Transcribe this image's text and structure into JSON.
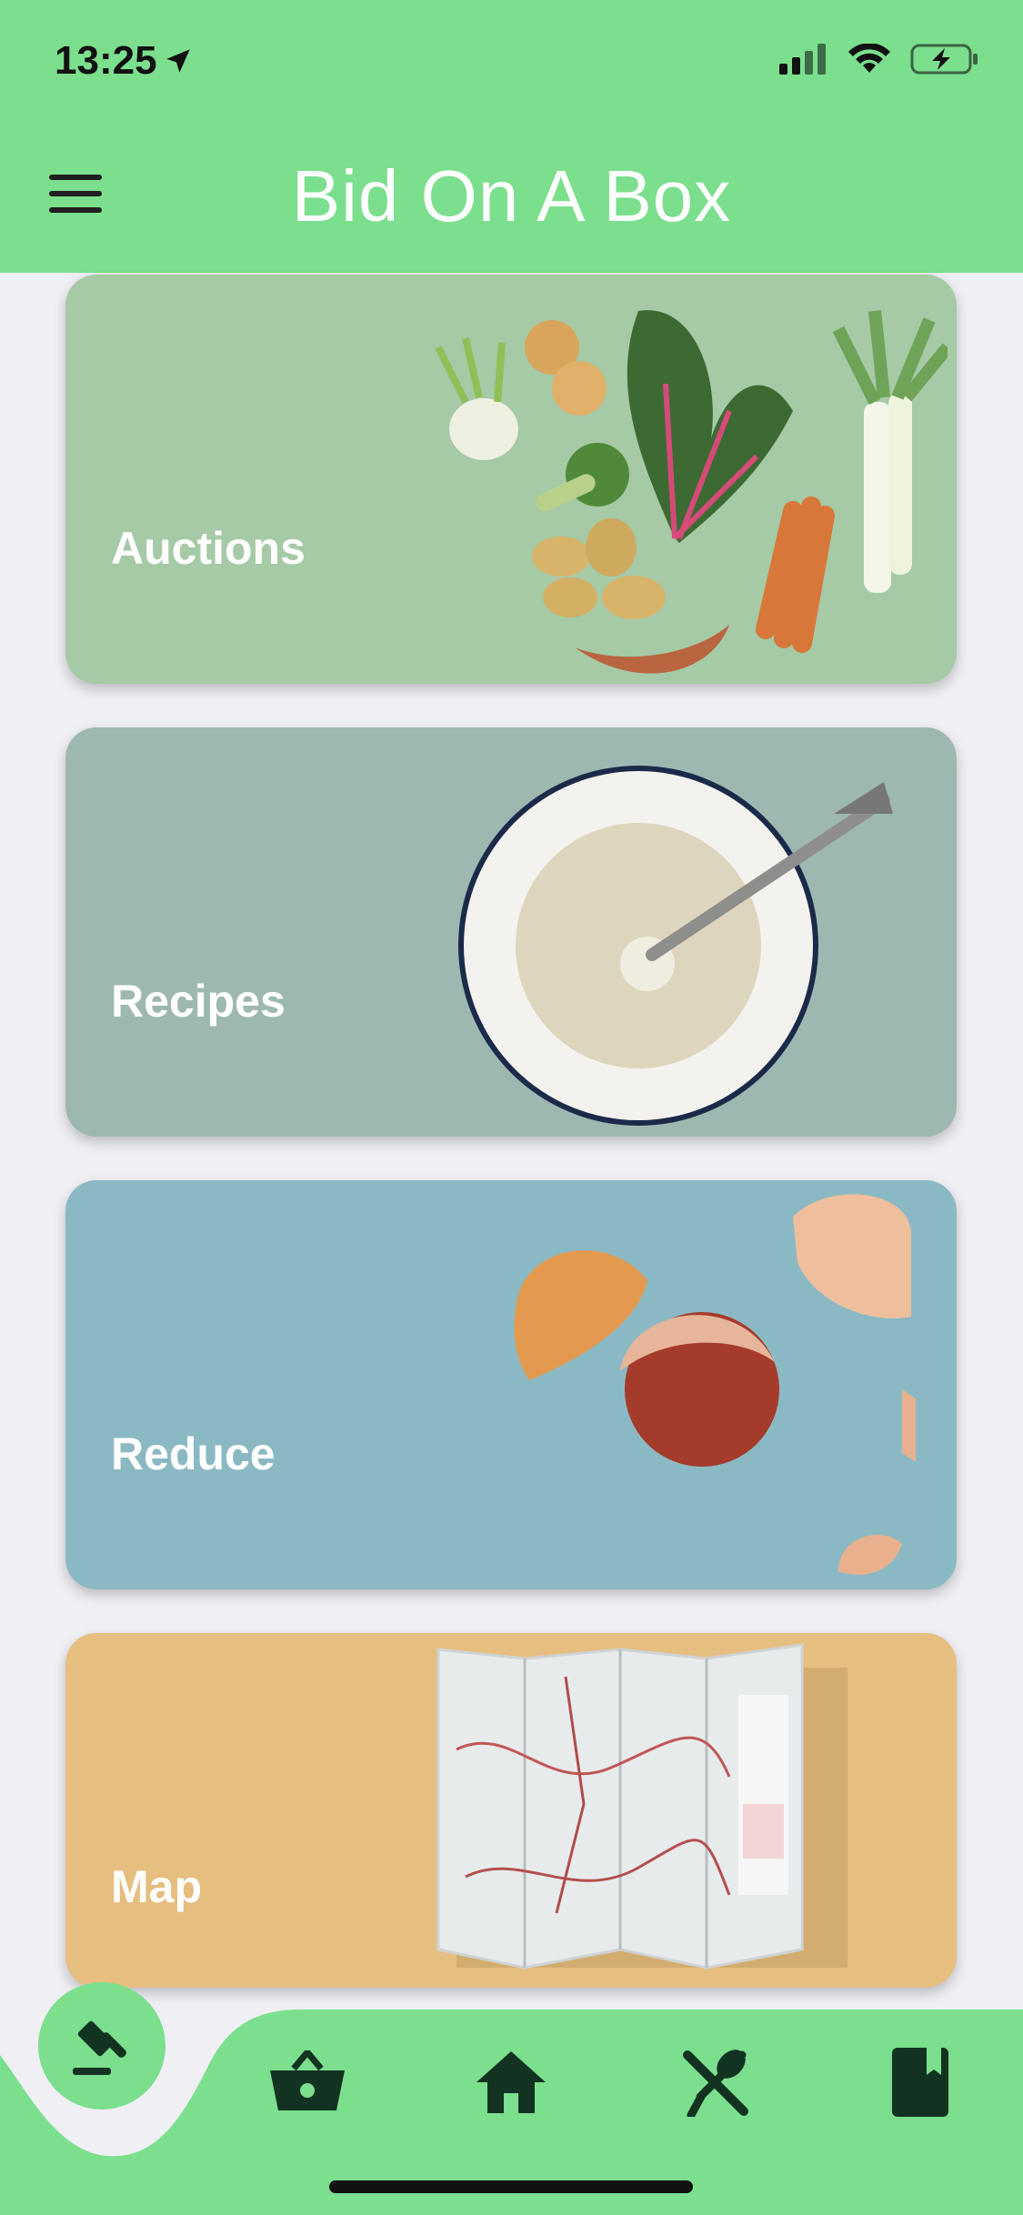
{
  "status": {
    "time": "13:25"
  },
  "header": {
    "title": "Bid On A Box"
  },
  "cards": [
    {
      "label": "Auctions",
      "color": "#A6C9A6"
    },
    {
      "label": "Recipes",
      "color": "#9DB8B1"
    },
    {
      "label": "Reduce",
      "color": "#8BB9C3"
    },
    {
      "label": "Map",
      "color": "#E5BE80"
    }
  ],
  "nav": {
    "items": [
      "gavel-icon",
      "basket-icon",
      "home-icon",
      "utensils-icon",
      "book-icon"
    ],
    "accent": "#7BDF8E",
    "icon_color": "#123322"
  }
}
